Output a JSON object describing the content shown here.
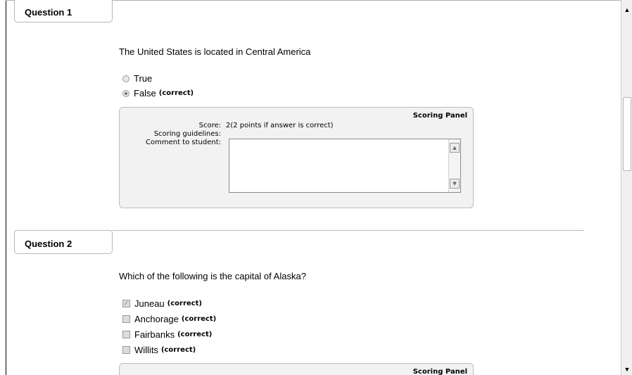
{
  "questions": [
    {
      "tab_label": "Question 1",
      "prompt": "The United States is located in Central America",
      "type": "radio",
      "options": [
        {
          "label": "True",
          "checked": false,
          "correct_tag": ""
        },
        {
          "label": "False",
          "checked": true,
          "correct_tag": "(correct)"
        }
      ],
      "scoring_panel": {
        "title": "Scoring Panel",
        "score_label": "Score:",
        "score_value": "2(2 points if answer is correct)",
        "guidelines_label": "Scoring guidelines:",
        "comment_label": "Comment to student:",
        "comment_value": ""
      }
    },
    {
      "tab_label": "Question 2",
      "prompt": "Which of the following is the capital of Alaska?",
      "type": "checkbox",
      "options": [
        {
          "label": "Juneau",
          "checked": true,
          "correct_tag": "(correct)"
        },
        {
          "label": "Anchorage",
          "checked": false,
          "correct_tag": "(correct)"
        },
        {
          "label": "Fairbanks",
          "checked": false,
          "correct_tag": "(correct)"
        },
        {
          "label": "Willits",
          "checked": false,
          "correct_tag": "(correct)"
        }
      ],
      "scoring_panel": {
        "title": "Scoring Panel"
      }
    }
  ],
  "scrollbar": {
    "up_icon": "arrow-up-icon",
    "down_icon": "arrow-down-icon"
  }
}
